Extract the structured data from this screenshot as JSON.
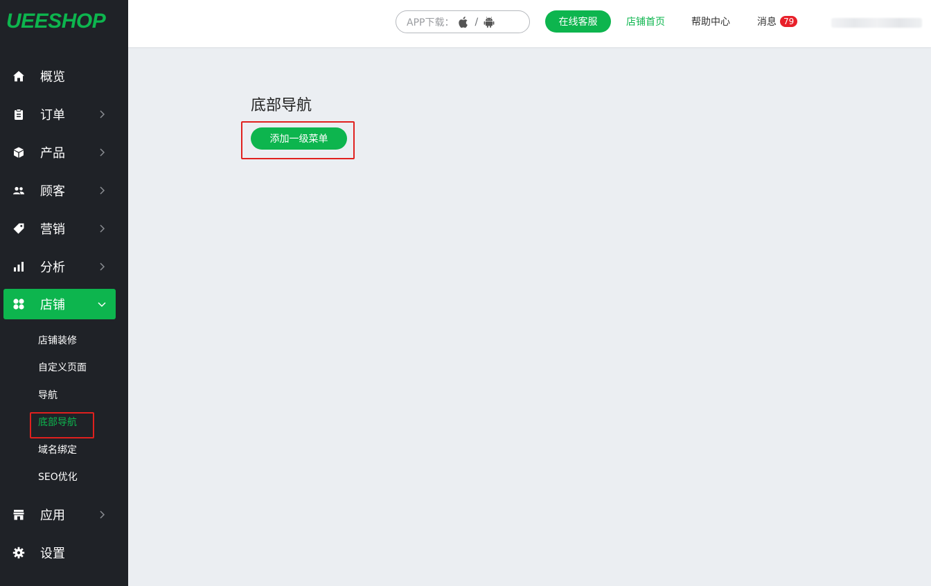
{
  "logo": "UEESHOP",
  "sidebar": {
    "items": [
      {
        "label": "概览"
      },
      {
        "label": "订单"
      },
      {
        "label": "产品"
      },
      {
        "label": "顾客"
      },
      {
        "label": "营销"
      },
      {
        "label": "分析"
      },
      {
        "label": "店铺"
      },
      {
        "label": "应用"
      },
      {
        "label": "设置"
      }
    ],
    "sub_items": [
      {
        "label": "店铺装修"
      },
      {
        "label": "自定义页面"
      },
      {
        "label": "导航"
      },
      {
        "label": "底部导航"
      },
      {
        "label": "域名绑定"
      },
      {
        "label": "SEO优化"
      }
    ]
  },
  "header": {
    "app_download": "APP下载：",
    "separator": "/",
    "online_service": "在线客服",
    "store_home": "店铺首页",
    "help_center": "帮助中心",
    "messages": "消息",
    "messages_count": "79"
  },
  "main": {
    "title": "底部导航",
    "add_button": "添加一级菜单"
  },
  "colors": {
    "brand_green": "#0db54e",
    "sidebar_bg": "#1f2227",
    "highlight_red": "#e0201e",
    "badge_red": "#e8202a"
  }
}
